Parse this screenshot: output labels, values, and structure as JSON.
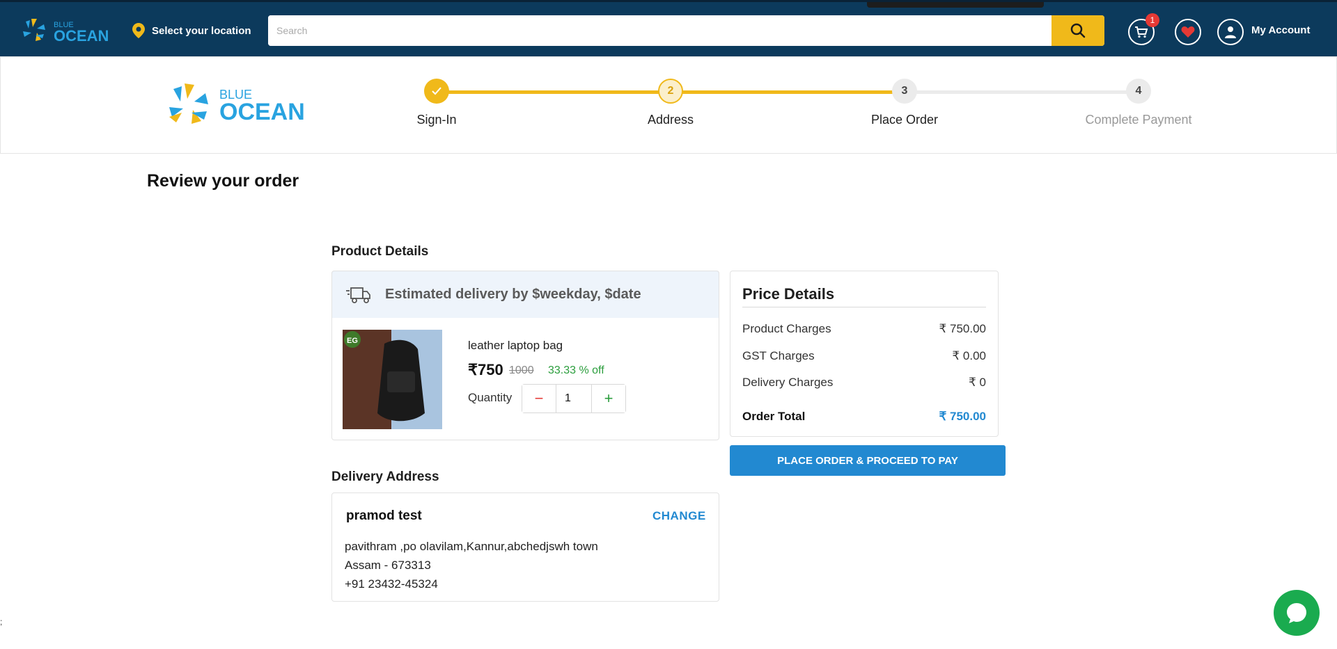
{
  "topbar": {
    "logo_small_top": "BLUE",
    "logo_small_bottom": "OCEAN",
    "location_label": "Select your location",
    "search_placeholder": "Search",
    "cart_count": "1",
    "account_label": "My Account"
  },
  "checkout_logo": {
    "top": "BLUE",
    "bottom": "OCEAN"
  },
  "steps": [
    {
      "number": "1",
      "label": "Sign-In",
      "state": "completed"
    },
    {
      "number": "2",
      "label": "Address",
      "state": "current"
    },
    {
      "number": "3",
      "label": "Place Order",
      "state": "pending"
    },
    {
      "number": "4",
      "label": "Complete Payment",
      "state": "pending"
    }
  ],
  "page_title": "Review your order",
  "product_section": {
    "title": "Product Details",
    "delivery_text": "Estimated delivery by $weekday, $date",
    "product": {
      "badge": "EG",
      "name": "leather laptop bag",
      "price": "₹750",
      "mrp": "1000",
      "discount": "33.33 % off",
      "quantity_label": "Quantity",
      "quantity": "1",
      "minus": "−",
      "plus": "+"
    }
  },
  "price_details": {
    "title": "Price Details",
    "rows": [
      {
        "label": "Product Charges",
        "value": "₹ 750.00"
      },
      {
        "label": "GST Charges",
        "value": "₹ 0.00"
      },
      {
        "label": "Delivery Charges",
        "value": "₹ 0"
      }
    ],
    "total_label": "Order Total",
    "total_value": "₹ 750.00",
    "cta": "PLACE ORDER & PROCEED TO PAY"
  },
  "address_section": {
    "title": "Delivery Address",
    "name": "pramod test",
    "change_label": "CHANGE",
    "lines": [
      "pavithram ,po olavilam,Kannur,abchedjswh town",
      "Assam - 673313",
      "+91 23432-45324"
    ]
  },
  "footer_char": ";",
  "colors": {
    "nav_bg": "#0c3a5c",
    "accent_yellow": "#f0b91a",
    "primary_blue": "#2289d1",
    "discount_green": "#2a9d3c",
    "chat_green": "#1aab4f"
  }
}
